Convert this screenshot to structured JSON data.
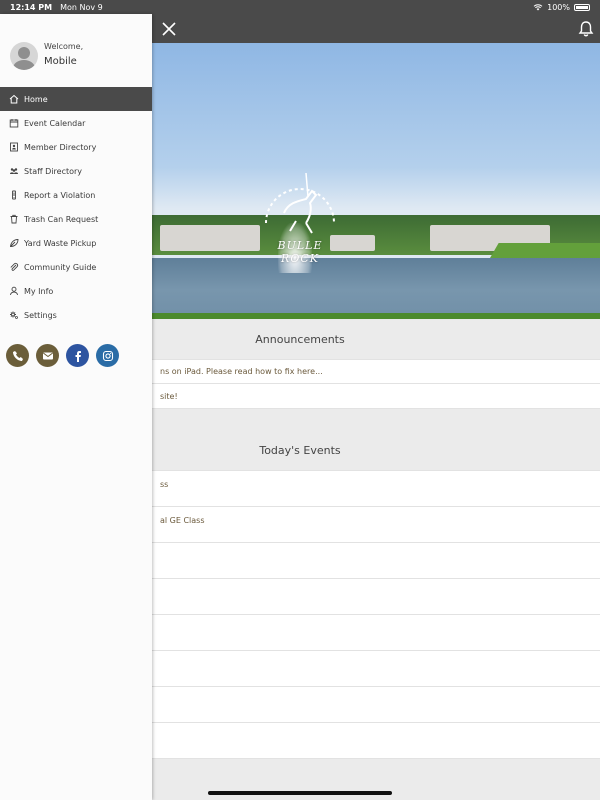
{
  "status_bar": {
    "time": "12:14 PM",
    "date": "Mon Nov 9",
    "battery": "100%"
  },
  "hero": {
    "brand_text": "BULLE ROCK"
  },
  "announcements": {
    "title": "Announcements",
    "items": [
      "ns on iPad. Please read how to fix here...",
      "site!"
    ]
  },
  "events": {
    "title": "Today's Events",
    "items": [
      "ss",
      "al GE Class",
      "",
      "",
      "",
      "",
      "",
      ""
    ]
  },
  "drawer": {
    "welcome_label": "Welcome,",
    "user_name": "Mobile",
    "menu": [
      {
        "label": "Home",
        "icon": "home-icon",
        "active": true
      },
      {
        "label": "Event Calendar",
        "icon": "calendar-icon"
      },
      {
        "label": "Member Directory",
        "icon": "member-directory-icon"
      },
      {
        "label": "Staff Directory",
        "icon": "staff-directory-icon"
      },
      {
        "label": "Report a Violation",
        "icon": "violation-icon"
      },
      {
        "label": "Trash Can Request",
        "icon": "trash-icon"
      },
      {
        "label": "Yard Waste Pickup",
        "icon": "leaf-icon"
      },
      {
        "label": "Community Guide",
        "icon": "paperclip-icon"
      },
      {
        "label": "My Info",
        "icon": "person-icon"
      },
      {
        "label": "Settings",
        "icon": "gear-icon"
      }
    ],
    "social": [
      {
        "icon": "phone-icon",
        "color": "#6b5e3a"
      },
      {
        "icon": "email-icon",
        "color": "#6b5e3a"
      },
      {
        "icon": "facebook-icon",
        "color": "#2d54a0"
      },
      {
        "icon": "instagram-icon",
        "color": "#2a6ca6"
      }
    ]
  },
  "colors": {
    "header": "#4a4a4a",
    "active_menu": "#4a4a4a",
    "section_bg": "#ebebeb",
    "event_text": "#6b5a3c"
  }
}
